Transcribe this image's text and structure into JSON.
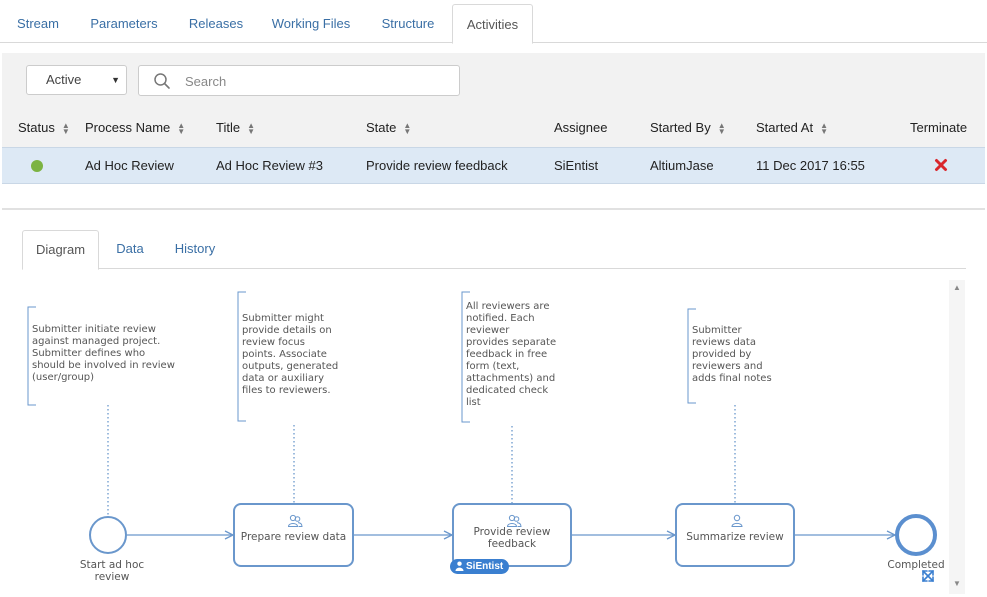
{
  "top_tabs": [
    {
      "label": "Stream"
    },
    {
      "label": "Parameters"
    },
    {
      "label": "Releases"
    },
    {
      "label": "Working Files"
    },
    {
      "label": "Structure"
    },
    {
      "label": "Activities",
      "active": true
    }
  ],
  "filter": {
    "state_value": "Active",
    "search_placeholder": "Search"
  },
  "table": {
    "columns": [
      {
        "label": "Status",
        "sortable": true
      },
      {
        "label": "Process Name",
        "sortable": true
      },
      {
        "label": "Title",
        "sortable": true
      },
      {
        "label": "State",
        "sortable": true
      },
      {
        "label": "Assignee",
        "sortable": false
      },
      {
        "label": "Started By",
        "sortable": true
      },
      {
        "label": "Started At",
        "sortable": true
      },
      {
        "label": "Terminate",
        "sortable": false
      }
    ],
    "rows": [
      {
        "status_color": "#7cb342",
        "process_name": "Ad Hoc Review",
        "title": "Ad Hoc Review #3",
        "state": "Provide review feedback",
        "assignee": "SiEntist",
        "started_by": "AltiumJase",
        "started_at": "11 Dec 2017 16:55",
        "terminate_icon": "close-icon"
      }
    ]
  },
  "sub_tabs": [
    {
      "label": "Diagram",
      "active": true
    },
    {
      "label": "Data"
    },
    {
      "label": "History"
    }
  ],
  "diagram": {
    "notes": [
      "Submitter initiate review\nagainst managed project.\nSubmitter defines who\nshould be involved in review\n(user/group)",
      "Submitter might\nprovide details on\nreview focus\npoints. Associate\noutputs, generated\ndata or auxiliary\nfiles to reviewers.",
      "All reviewers are\nnotified. Each\nreviewer\nprovides separate\nfeedback in free\nform (text,\nattachments) and\ndedicated check\nlist",
      "Submitter\nreviews data\nprovided by\nreviewers and\nadds final notes"
    ],
    "start_event_label": "Start ad hoc\nreview",
    "tasks": [
      {
        "label": "Prepare review data",
        "icon": "users-icon"
      },
      {
        "label": "Provide review\nfeedback",
        "icon": "users-icon",
        "assignee_badge": "SiEntist"
      },
      {
        "label": "Summarize review",
        "icon": "user-icon"
      }
    ],
    "end_event_label": "Completed",
    "colors": {
      "flow": "#6a97cc",
      "start_event": "#6a97cc",
      "end_event": "#5b8fcf",
      "badge": "#3a7fd0"
    }
  }
}
